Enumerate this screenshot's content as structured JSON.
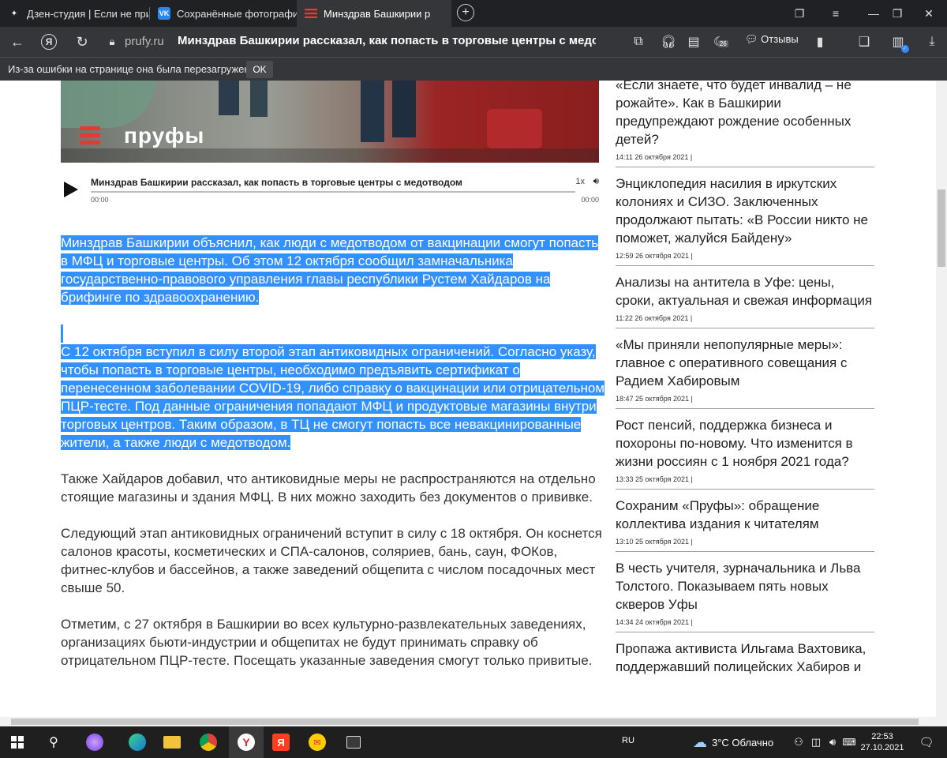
{
  "browser": {
    "tabs": [
      {
        "title": "Дзен-студия | Если не при",
        "icon": "zen-icon"
      },
      {
        "title": "Сохранённые фотографи",
        "icon": "vk-icon"
      },
      {
        "title": "Минздрав Башкирии р",
        "icon": "prufy-icon",
        "active": true
      }
    ],
    "address": {
      "domain": "prufy.ru",
      "page_title": "Минздрав Башкирии рассказал, как попасть в торговые центры с медотво..."
    },
    "toolbar": {
      "badge_count": "26",
      "reviews_label": "Отзывы"
    },
    "infobar": {
      "message": "Из-за ошибки на странице она была перезагружена",
      "ok_label": "OK"
    }
  },
  "article": {
    "hero_logo": "пруфы",
    "audio": {
      "title": "Минздрав Башкирии рассказал, как попасть в торговые центры с медотводом",
      "current": "00:00",
      "duration": "00:00",
      "speed": "1x"
    },
    "paragraphs": [
      "Минздрав Башкирии объяснил, как люди с медотводом от вакцинации смогут попасть в МФЦ и торговые центры. Об этом 12 октября сообщил замначальника государственно-правового управления главы республики Рустем Хайдаров на брифинге по здравоохранению.",
      "С 12 октября вступил в силу второй этап антиковидных ограничений. Согласно указу, чтобы попасть в торговые центры, необходимо предъявить сертификат о перенесенном заболевании COVID-19, либо справку о вакцинации или отрицательном ПЦР-тесте. Под данные ограничения попадают МФЦ и продуктовые магазины внутри торговых центров. Таким образом, в ТЦ не смогут попасть все невакцинированные жители, а также люди с медотводом.",
      "Также Хайдаров добавил, что антиковидные меры не распространяются на отдельно стоящие магазины и здания МФЦ. В них можно заходить без документов о прививке.",
      "Следующий этап антиковидных ограничений вступит в силу с 18 октября. Он коснется салонов красоты, косметических и СПА-салонов, соляриев, бань, саун, ФОКов, фитнес-клубов и бассейнов, а также заведений общепита с числом посадочных мест свыше 50.",
      "Отметим, с 27 октября в Башкирии во всех культурно-развлекательных заведениях, организациях бьюти-индустрии и общепитах не будут принимать справку об отрицательном ПЦР-тесте. Посещать указанные заведения смогут только привитые."
    ]
  },
  "sidebar": {
    "news": [
      {
        "title": "«Если знаете, что будет инвалид – не рожайте». Как в Башкирии предупреждают рождение особенных детей?",
        "time": "14:11 26 октября 2021 |"
      },
      {
        "title": "Энциклопедия насилия в иркутских колониях и СИЗО. Заключенных продолжают пытать: «В России никто не поможет, жалуйся Байдену»",
        "time": "12:59 26 октября 2021 |"
      },
      {
        "title": "Анализы на антитела в Уфе: цены, сроки, актуальная и свежая информация",
        "time": "11:22 26 октября 2021 |"
      },
      {
        "title": "«Мы приняли непопулярные меры»: главное с оперативного совещания с Радием Хабировым",
        "time": "18:47 25 октября 2021 |"
      },
      {
        "title": "Рост пенсий, поддержка бизнеса и похороны по-новому. Что изменится в жизни россиян с 1 ноября 2021 года?",
        "time": "13:33 25 октября 2021 |"
      },
      {
        "title": "Сохраним «Пруфы»: обращение коллектива издания к читателям",
        "time": "13:10 25 октября 2021 |"
      },
      {
        "title": "В честь учителя, зурначальника и Льва Толстого. Показываем пять новых скверов Уфы",
        "time": "14:34 24 октября 2021 |"
      },
      {
        "title": "Пропажа активиста Ильгама Вахтовика, поддержавший полицейских Хабиров и",
        "time": ""
      }
    ]
  },
  "taskbar": {
    "lang": "RU",
    "weather": "3°C  Облачно",
    "time": "22:53",
    "date": "27.10.2021"
  }
}
